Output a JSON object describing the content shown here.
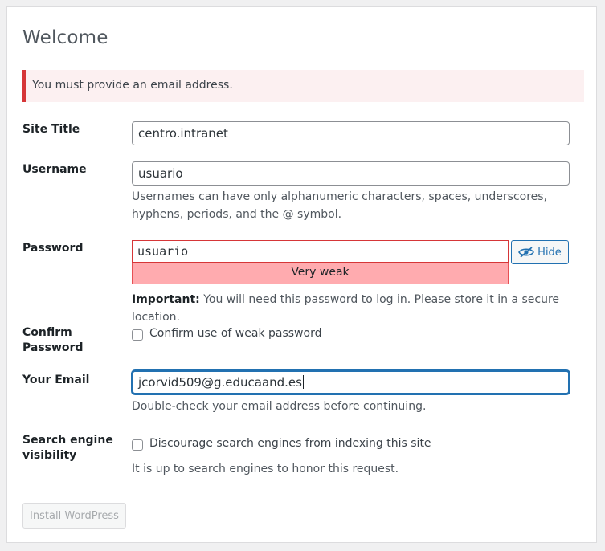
{
  "page": {
    "title": "Welcome",
    "error": "You must provide an email address."
  },
  "fields": {
    "site_title": {
      "label": "Site Title",
      "value": "centro.intranet"
    },
    "username": {
      "label": "Username",
      "value": "usuario",
      "description": "Usernames can have only alphanumeric characters, spaces, underscores, hyphens, periods, and the @ symbol."
    },
    "password": {
      "label": "Password",
      "value": "usuario",
      "strength": "Very weak",
      "hide_label": "Hide",
      "important_prefix": "Important:",
      "important_text": " You will need this password to log in. Please store it in a secure location."
    },
    "confirm": {
      "label_line1": "Confirm",
      "label_line2": "Password",
      "checkbox_label": "Confirm use of weak password",
      "checked": false
    },
    "email": {
      "label": "Your Email",
      "value": "jcorvid509@g.educaand.es",
      "description": "Double-check your email address before continuing."
    },
    "search": {
      "label_line1": "Search engine",
      "label_line2": "visibility",
      "checkbox_label": "Discourage search engines from indexing this site",
      "checked": false,
      "description": "It is up to search engines to honor this request."
    }
  },
  "actions": {
    "install_label": "Install WordPress"
  },
  "colors": {
    "accent": "#2271b1",
    "error": "#d63638",
    "error_bg": "#fcf0f1",
    "strength_bg": "#ffabaf"
  },
  "icons": {
    "hide_icon": "eye-slash-icon"
  }
}
